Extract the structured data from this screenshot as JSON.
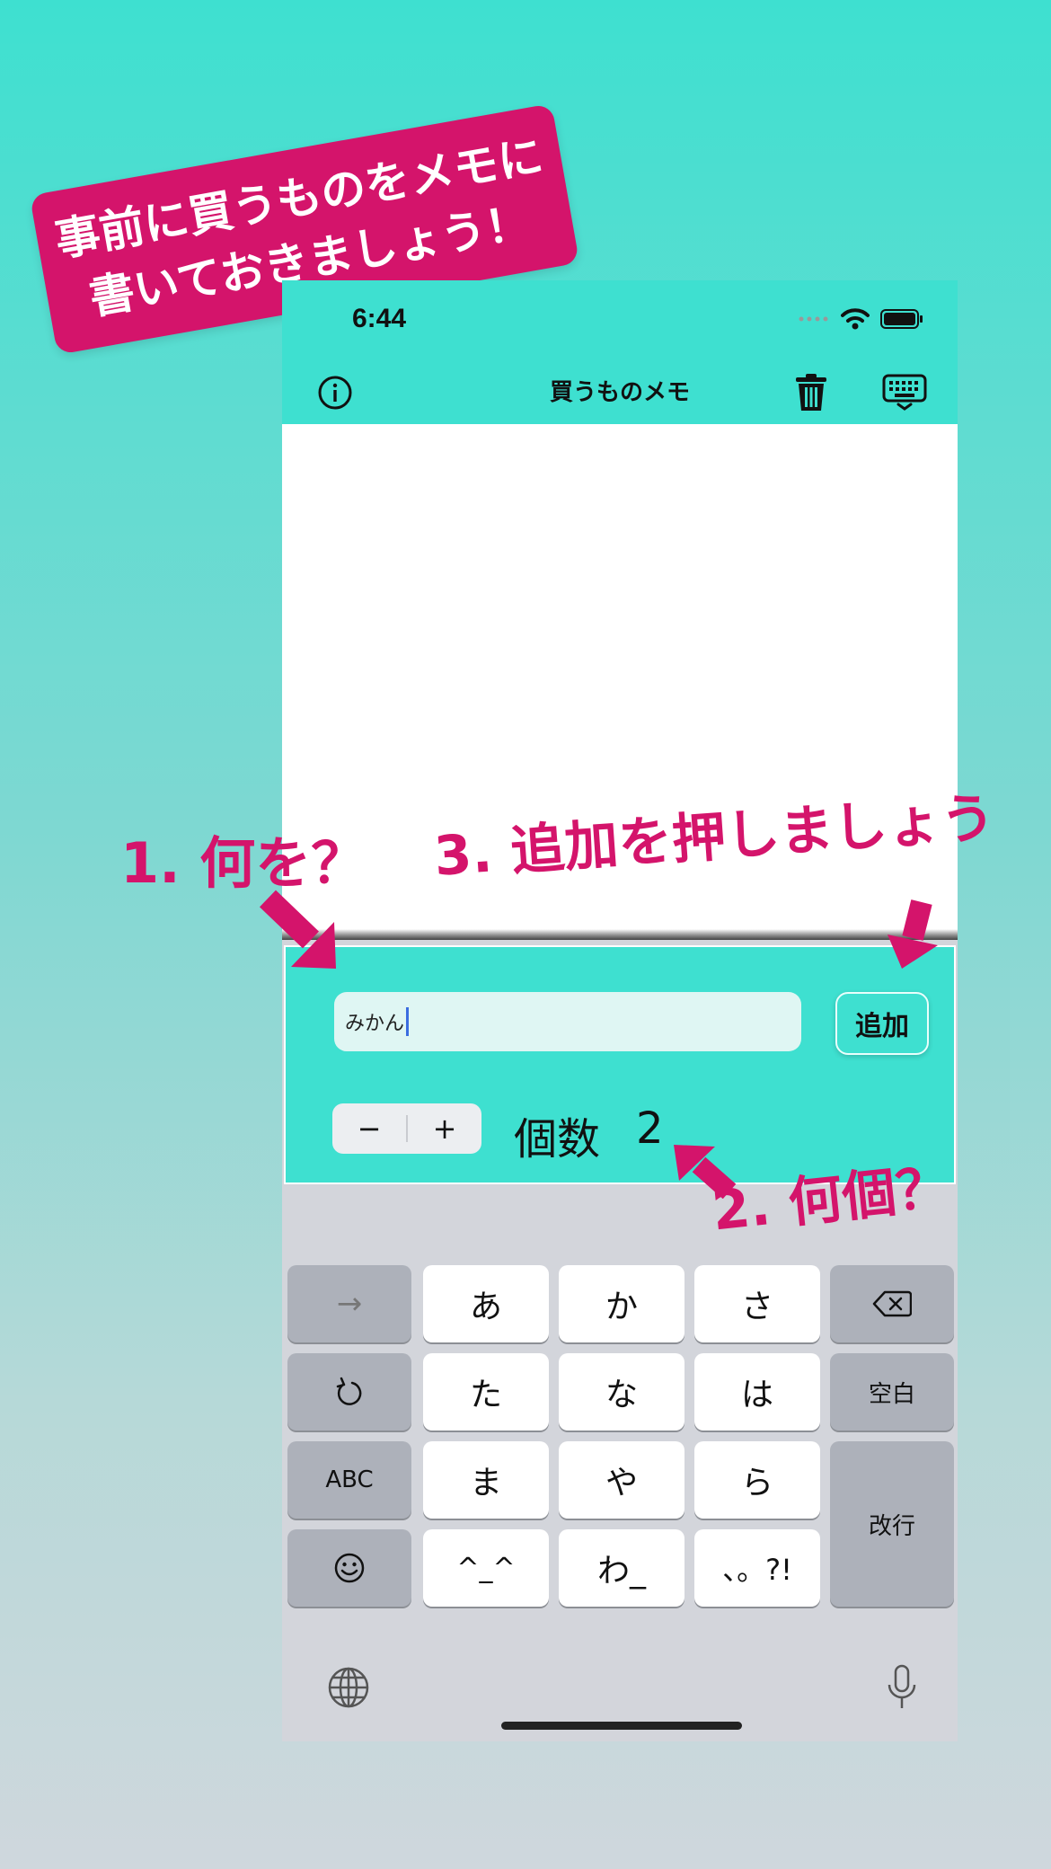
{
  "banner": {
    "line1": "事前に買うものをメモに",
    "line2": "書いておきましょう！"
  },
  "annotations": {
    "step1": "1. 何を？",
    "step2": "2. 何個？",
    "step3": "3. 追加を押しましょう"
  },
  "status_bar": {
    "time": "6:44"
  },
  "nav": {
    "title": "買うものメモ",
    "info_icon": "info-icon",
    "trash_icon": "trash-icon",
    "keyboard_icon": "keyboard-dismiss-icon"
  },
  "item_input": {
    "value": "みかん"
  },
  "add_button": {
    "label": "追加"
  },
  "stepper": {
    "minus": "−",
    "plus": "+"
  },
  "quantity": {
    "label": "個数",
    "value": "2"
  },
  "keyboard": {
    "arrow": "→",
    "a": "あ",
    "ka": "か",
    "sa": "さ",
    "ta": "た",
    "na": "な",
    "ha": "は",
    "space": "空白",
    "abc": "ABC",
    "ma": "ま",
    "ya": "や",
    "ra": "ら",
    "return": "改行",
    "kaomoji": "^_^",
    "wa": "わ_",
    "punct": "、。?!"
  },
  "colors": {
    "accent": "#3ee0d0",
    "annotation": "#d4146b"
  }
}
